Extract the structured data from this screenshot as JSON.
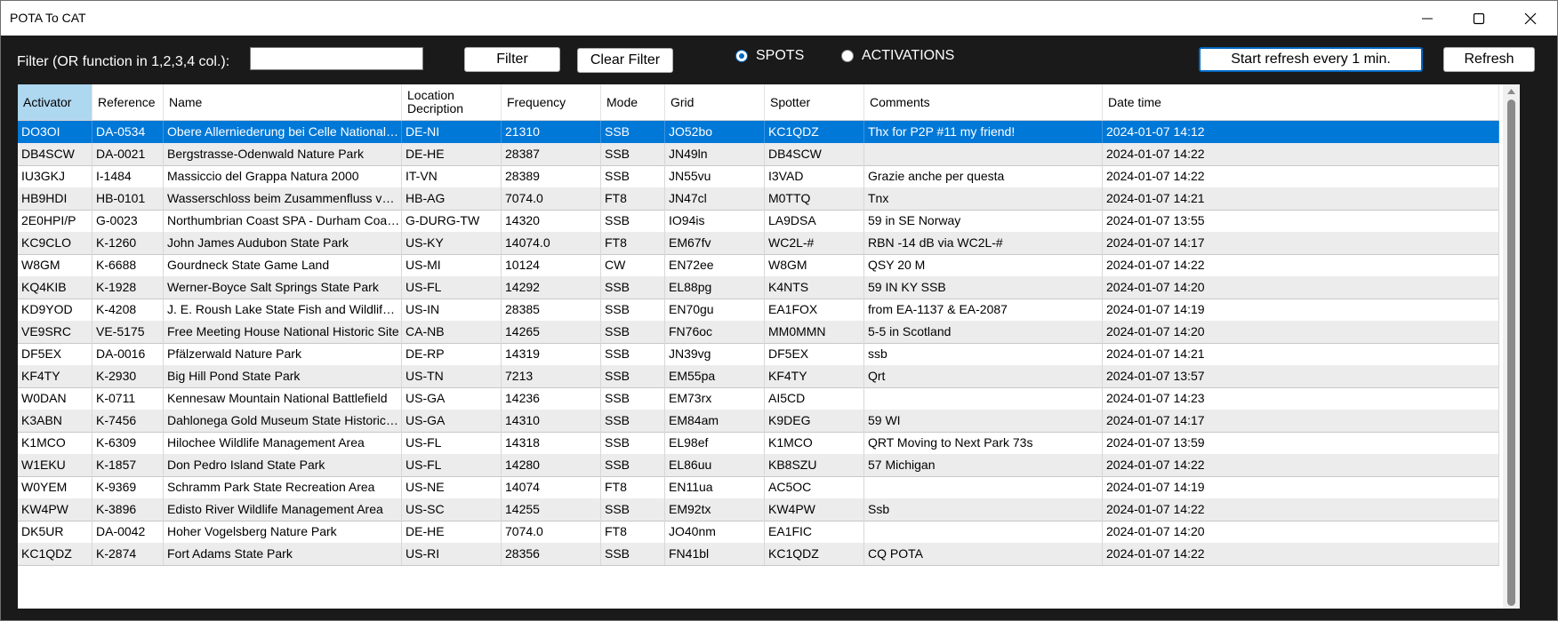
{
  "window": {
    "title": "POTA To CAT"
  },
  "toolbar": {
    "filter_label": "Filter (OR function in 1,2,3,4 col.):",
    "filter_value": "",
    "filter_button": "Filter",
    "clear_filter_button": "Clear Filter",
    "radio_spots": "SPOTS",
    "radio_activations": "ACTIVATIONS",
    "selected_mode": "SPOTS",
    "start_refresh_button": "Start refresh every 1 min.",
    "refresh_button": "Refresh"
  },
  "colors": {
    "selection": "#0078d7",
    "accent": "#0067c0",
    "header_active": "#aed7f0"
  },
  "table": {
    "columns": [
      "Activator",
      "Reference",
      "Name",
      "Location Decription",
      "Frequency",
      "Mode",
      "Grid",
      "Spotter",
      "Comments",
      "Date time"
    ],
    "sorted_column": "Activator",
    "selected_row_index": 0,
    "rows": [
      [
        "DO3OI",
        "DA-0534",
        "Obere Allerniederung bei Celle National Nat...",
        "DE-NI",
        "21310",
        "SSB",
        "JO52bo",
        "KC1QDZ",
        "Thx for P2P #11 my friend!",
        "2024-01-07 14:12"
      ],
      [
        "DB4SCW",
        "DA-0021",
        "Bergstrasse-Odenwald Nature Park",
        "DE-HE",
        "28387",
        "SSB",
        "JN49ln",
        "DB4SCW",
        "",
        "2024-01-07 14:22"
      ],
      [
        "IU3GKJ",
        "I-1484",
        "Massiccio del Grappa Natura 2000",
        "IT-VN",
        "28389",
        "SSB",
        "JN55vu",
        "I3VAD",
        "Grazie anche per questa",
        "2024-01-07 14:22"
      ],
      [
        "HB9HDI",
        "HB-0101",
        "Wasserschloss beim Zusammenfluss von A...",
        "HB-AG",
        "7074.0",
        "FT8",
        "JN47cl",
        "M0TTQ",
        "Tnx",
        "2024-01-07 14:21"
      ],
      [
        "2E0HPI/P",
        "G-0023",
        "Northumbrian Coast SPA - Durham Coast (S...",
        "G-DURG-TW",
        "14320",
        "SSB",
        "IO94is",
        "LA9DSA",
        "59 in SE Norway",
        "2024-01-07 13:55"
      ],
      [
        "KC9CLO",
        "K-1260",
        "John James Audubon State Park",
        "US-KY",
        "14074.0",
        "FT8",
        "EM67fv",
        "WC2L-#",
        "RBN -14 dB via WC2L-#",
        "2024-01-07 14:17"
      ],
      [
        "W8GM",
        "K-6688",
        "Gourdneck State Game Land",
        "US-MI",
        "10124",
        "CW",
        "EN72ee",
        "W8GM",
        "QSY 20 M",
        "2024-01-07 14:22"
      ],
      [
        "KQ4KIB",
        "K-1928",
        "Werner-Boyce Salt Springs State Park",
        "US-FL",
        "14292",
        "SSB",
        "EL88pg",
        "K4NTS",
        "59 IN KY SSB",
        "2024-01-07 14:20"
      ],
      [
        "KD9YOD",
        "K-4208",
        "J. E. Roush Lake State Fish and Wildlife Area",
        "US-IN",
        "28385",
        "SSB",
        "EN70gu",
        "EA1FOX",
        "from EA-1137 & EA-2087",
        "2024-01-07 14:19"
      ],
      [
        "VE9SRC",
        "VE-5175",
        "Free Meeting House National Historic Site",
        "CA-NB",
        "14265",
        "SSB",
        "FN76oc",
        "MM0MMN",
        "5-5 in Scotland",
        "2024-01-07 14:20"
      ],
      [
        "DF5EX",
        "DA-0016",
        "Pfälzerwald Nature Park",
        "DE-RP",
        "14319",
        "SSB",
        "JN39vg",
        "DF5EX",
        "ssb",
        "2024-01-07 14:21"
      ],
      [
        "KF4TY",
        "K-2930",
        "Big Hill Pond State Park",
        "US-TN",
        "7213",
        "SSB",
        "EM55pa",
        "KF4TY",
        "Qrt",
        "2024-01-07 13:57"
      ],
      [
        "W0DAN",
        "K-0711",
        "Kennesaw Mountain National Battlefield",
        "US-GA",
        "14236",
        "SSB",
        "EM73rx",
        "AI5CD",
        "",
        "2024-01-07 14:23"
      ],
      [
        "K3ABN",
        "K-7456",
        "Dahlonega Gold Museum State Historic Site",
        "US-GA",
        "14310",
        "SSB",
        "EM84am",
        "K9DEG",
        "59 WI",
        "2024-01-07 14:17"
      ],
      [
        "K1MCO",
        "K-6309",
        "Hilochee Wildlife Management Area",
        "US-FL",
        "14318",
        "SSB",
        "EL98ef",
        "K1MCO",
        "QRT Moving to Next Park 73s",
        "2024-01-07 13:59"
      ],
      [
        "W1EKU",
        "K-1857",
        "Don Pedro Island State Park",
        "US-FL",
        "14280",
        "SSB",
        "EL86uu",
        "KB8SZU",
        "57 Michigan",
        "2024-01-07 14:22"
      ],
      [
        "W0YEM",
        "K-9369",
        "Schramm Park State Recreation Area",
        "US-NE",
        "14074",
        "FT8",
        "EN11ua",
        "AC5OC",
        "",
        "2024-01-07 14:19"
      ],
      [
        "KW4PW",
        "K-3896",
        "Edisto River Wildlife Management Area",
        "US-SC",
        "14255",
        "SSB",
        "EM92tx",
        "KW4PW",
        "Ssb",
        "2024-01-07 14:22"
      ],
      [
        "DK5UR",
        "DA-0042",
        "Hoher Vogelsberg Nature Park",
        "DE-HE",
        "7074.0",
        "FT8",
        "JO40nm",
        "EA1FIC",
        "",
        "2024-01-07 14:20"
      ],
      [
        "KC1QDZ",
        "K-2874",
        "Fort Adams State Park",
        "US-RI",
        "28356",
        "SSB",
        "FN41bl",
        "KC1QDZ",
        "CQ POTA",
        "2024-01-07 14:22"
      ]
    ]
  }
}
